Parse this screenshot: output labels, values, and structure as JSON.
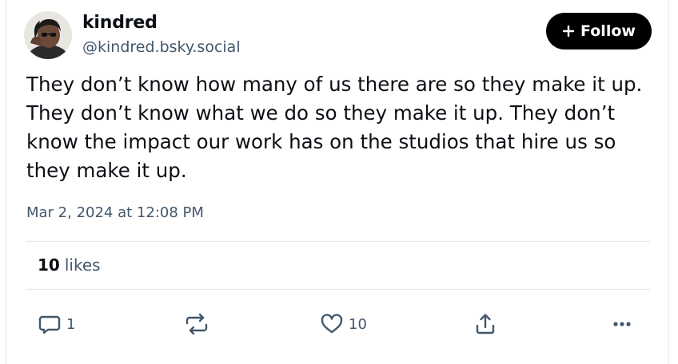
{
  "author": {
    "display_name": "kindred",
    "handle": "@kindred.bsky.social"
  },
  "follow_button": {
    "label": "Follow"
  },
  "post": {
    "text": "They don’t know how many of us there are so they make it up. They don’t know what we do so they make it up. They don’t know the impact our work has on the studios that hire us so they make it up.",
    "timestamp": "Mar 2, 2024 at 12:08 PM"
  },
  "stats": {
    "likes_count": "10",
    "likes_label": "likes"
  },
  "actions": {
    "reply_count": "1",
    "like_count": "10"
  },
  "icons": {
    "reply": "speech-bubble-icon",
    "repost": "repost-arrows-icon",
    "like": "heart-icon",
    "share": "share-upload-icon",
    "more": "more-dots-icon",
    "follow": "plus-icon"
  },
  "colors": {
    "follow_bg": "#000000",
    "secondary_text": "#42576c",
    "primary_text": "#0b0f14"
  }
}
